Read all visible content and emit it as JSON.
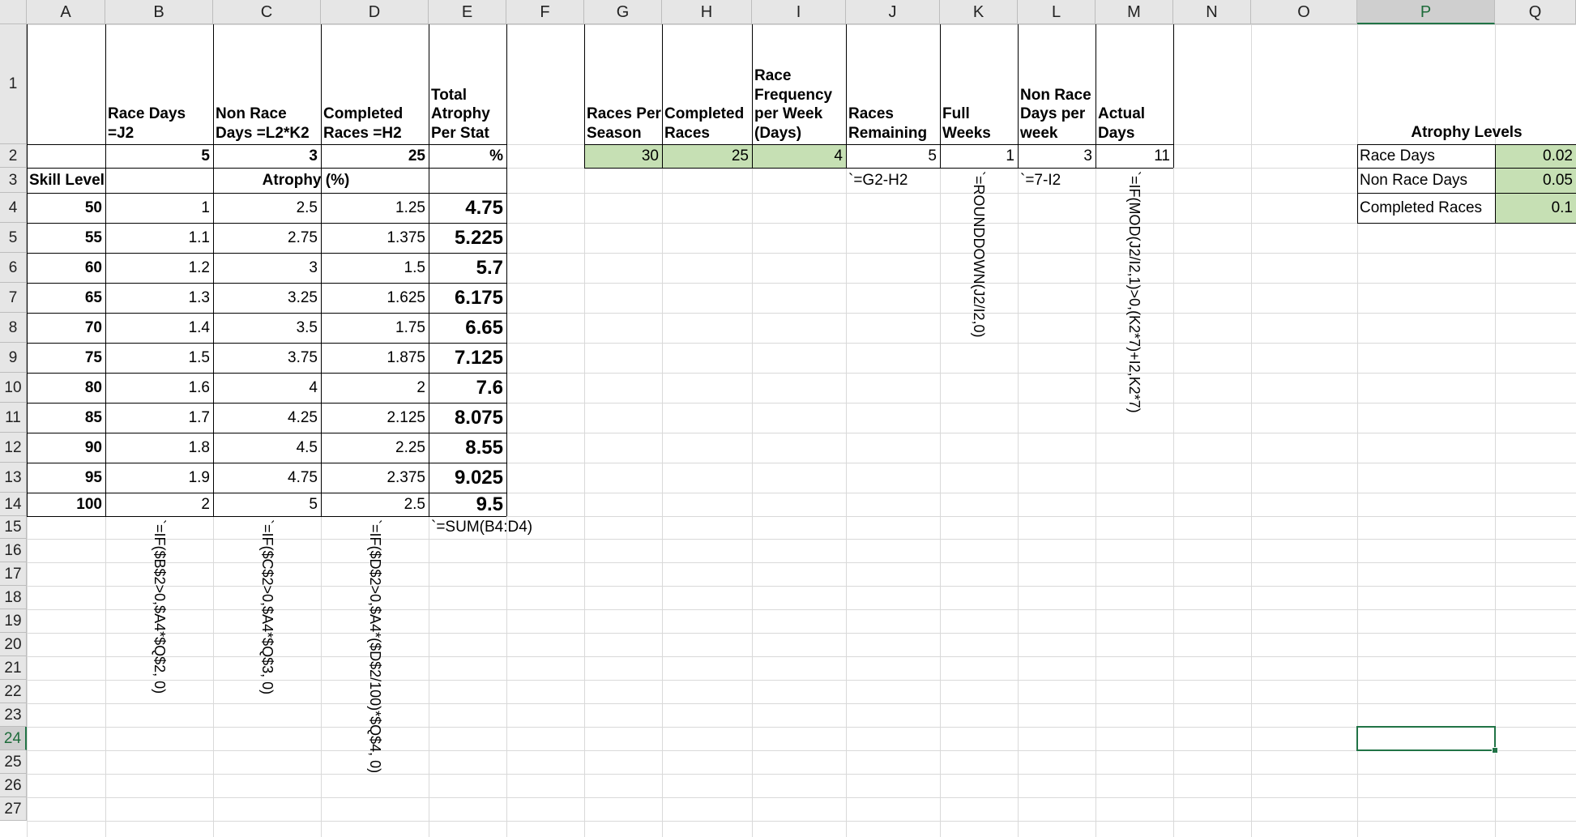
{
  "columns": [
    "A",
    "B",
    "C",
    "D",
    "E",
    "F",
    "G",
    "H",
    "I",
    "J",
    "K",
    "L",
    "M",
    "N",
    "O",
    "P",
    "Q"
  ],
  "rows": [
    "1",
    "2",
    "3",
    "4",
    "5",
    "6",
    "7",
    "8",
    "9",
    "10",
    "11",
    "12",
    "13",
    "14",
    "15",
    "16",
    "17",
    "18",
    "19",
    "20",
    "21",
    "22",
    "23",
    "24",
    "25",
    "26",
    "27"
  ],
  "selected_cell": "P24",
  "accent_color": "#217346",
  "input_fill_color": "#c6e0b4",
  "headers": {
    "race_days": "Race Days =J2",
    "non_race_days": "Non Race Days =L2*K2",
    "completed_races": "Completed Races =H2",
    "total_atrophy": "Total Atrophy Per Stat",
    "races_per_season": "Races Per Season",
    "completed_races_g": "Completed Races",
    "race_frequency": "Race Frequency per Week (Days)",
    "races_remaining": "Races Remaining",
    "full_weeks": "Full Weeks",
    "non_race_days_week": "Non Race Days per week",
    "actual_days": "Actual Days",
    "atrophy_levels": "Atrophy Levels"
  },
  "row2": {
    "b": "5",
    "c": "3",
    "d": "25",
    "e": "%",
    "g": "30",
    "h": "25",
    "i": "4",
    "j": "5",
    "k": "1",
    "l": "3",
    "m": "11"
  },
  "row3": {
    "skill_level": "Skill Level",
    "atrophy": "Atrophy (%)",
    "j_formula": "`=G2-H2",
    "l_formula": "`=7-I2"
  },
  "atrophy_levels": [
    {
      "label": "Race Days",
      "value": "0.02"
    },
    {
      "label": "Non Race Days",
      "value": "0.05"
    },
    {
      "label": "Completed Races",
      "value": "0.1"
    }
  ],
  "table": [
    {
      "skill": "50",
      "b": "1",
      "c": "2.5",
      "d": "1.25",
      "e": "4.75"
    },
    {
      "skill": "55",
      "b": "1.1",
      "c": "2.75",
      "d": "1.375",
      "e": "5.225"
    },
    {
      "skill": "60",
      "b": "1.2",
      "c": "3",
      "d": "1.5",
      "e": "5.7"
    },
    {
      "skill": "65",
      "b": "1.3",
      "c": "3.25",
      "d": "1.625",
      "e": "6.175"
    },
    {
      "skill": "70",
      "b": "1.4",
      "c": "3.5",
      "d": "1.75",
      "e": "6.65"
    },
    {
      "skill": "75",
      "b": "1.5",
      "c": "3.75",
      "d": "1.875",
      "e": "7.125"
    },
    {
      "skill": "80",
      "b": "1.6",
      "c": "4",
      "d": "2",
      "e": "7.6"
    },
    {
      "skill": "85",
      "b": "1.7",
      "c": "4.25",
      "d": "2.125",
      "e": "8.075"
    },
    {
      "skill": "90",
      "b": "1.8",
      "c": "4.5",
      "d": "2.25",
      "e": "8.55"
    },
    {
      "skill": "95",
      "b": "1.9",
      "c": "4.75",
      "d": "2.375",
      "e": "9.025"
    },
    {
      "skill": "100",
      "b": "2",
      "c": "5",
      "d": "2.5",
      "e": "9.5"
    }
  ],
  "formulas": {
    "sum": "`=SUM(B4:D4)",
    "b": "`=IF($B$2>0,$A4*$Q$2, 0)",
    "c": "`=IF($C$2>0,$A4*$Q$3, 0)",
    "d": "`=IF($D$2>0,$A4*($D$2/100)*$Q$4, 0)",
    "k": "`=ROUNDDOWN(J2/I2,0)",
    "m": "`=IF(MOD(J2/I2,1)>0,(K2*7)+I2,K2*7)"
  }
}
